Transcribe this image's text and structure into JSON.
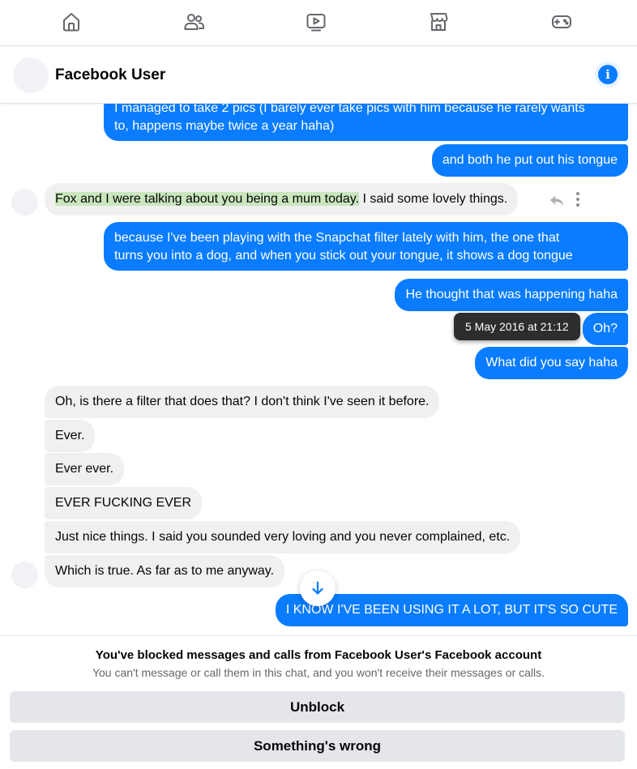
{
  "nav": {
    "items": [
      {
        "icon": "home-icon"
      },
      {
        "icon": "friends-icon"
      },
      {
        "icon": "watch-icon"
      },
      {
        "icon": "marketplace-icon"
      },
      {
        "icon": "gaming-icon"
      }
    ]
  },
  "chat_header": {
    "title": "Facebook User",
    "info_icon": "info-icon",
    "info_glyph": "i"
  },
  "messages": [
    {
      "side": "out",
      "text_line1": "I managed to take 2 pics (I barely ever take pics with him because he rarely wants",
      "text_line2": "to, happens maybe twice a year haha)"
    },
    {
      "side": "out",
      "text": "and both he put out his tongue"
    },
    {
      "side": "in",
      "highlighted": "Fox and I were talking about you being a mum today.",
      "rest": " I said some lovely things."
    },
    {
      "side": "out",
      "text_line1": "because I've been playing with the Snapchat filter lately with him, the one that",
      "text_line2": "turns you into a dog, and when you stick out your tongue, it shows a dog tongue"
    },
    {
      "side": "out",
      "text": "He thought that was happening haha"
    },
    {
      "side": "out",
      "text": "Oh?"
    },
    {
      "side": "out",
      "text": "What did you say haha"
    },
    {
      "side": "in",
      "text": "Oh, is there a filter that does that? I don't think I've seen it before."
    },
    {
      "side": "in",
      "text": "Ever."
    },
    {
      "side": "in",
      "text": "Ever ever."
    },
    {
      "side": "in",
      "text": "EVER FUCKING EVER"
    },
    {
      "side": "in",
      "text": "Just nice things. I said you sounded very loving and you never complained, etc."
    },
    {
      "side": "in",
      "text": "Which is true. As far as to me anyway."
    },
    {
      "side": "out",
      "text": "I KNOW I'VE BEEN USING IT A LOT, BUT IT'S SO CUTE"
    }
  ],
  "tooltip": "5 May 2016 at 21:12",
  "blocked": {
    "title": "You've blocked messages and calls from Facebook User's Facebook account",
    "subtitle": "You can't message or call them in this chat, and you won't receive their messages or calls.",
    "unblock_label": "Unblock",
    "wrong_label": "Something's wrong"
  },
  "colors": {
    "outgoing_bubble": "#0a7cff",
    "incoming_bubble": "#f0f0f0",
    "highlight": "#c9e6bd"
  }
}
